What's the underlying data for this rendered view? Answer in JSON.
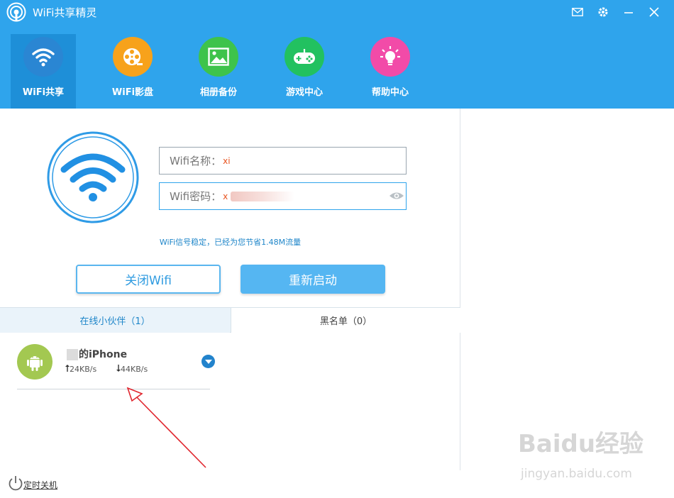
{
  "app": {
    "title": "WiFi共享精灵"
  },
  "colors": {
    "header": "#2fa4ec",
    "accent": "#1f86c9",
    "password_value": "#e8531f"
  },
  "nav": {
    "items": [
      {
        "label": "WiFi共享",
        "icon": "wifi-icon",
        "color": "#2a86d3"
      },
      {
        "label": "WiFi影盘",
        "icon": "film-reel-icon",
        "color": "#f7a21b"
      },
      {
        "label": "相册备份",
        "icon": "photo-icon",
        "color": "#3ec34b"
      },
      {
        "label": "游戏中心",
        "icon": "gamepad-icon",
        "color": "#22c160"
      },
      {
        "label": "帮助中心",
        "icon": "lightbulb-icon",
        "color": "#f24ba8"
      }
    ]
  },
  "form": {
    "name_label": "Wifi名称：",
    "name_value": "xi",
    "password_label": "Wifi密码：",
    "password_value": "x"
  },
  "status": "WiFi信号稳定，已经为您节省1.48M流量",
  "buttons": {
    "close_wifi": "关闭Wifi",
    "restart": "重新启动"
  },
  "tabs": {
    "online": "在线小伙伴（1）",
    "blacklist": "黑名单（0）"
  },
  "device": {
    "name": "的iPhone",
    "upload": "24KB/s",
    "download": "44KB/s"
  },
  "footer": {
    "timer_shutdown": "定时关机"
  },
  "watermark": {
    "brand": "Baidu经验",
    "url": "jingyan.baidu.com"
  }
}
